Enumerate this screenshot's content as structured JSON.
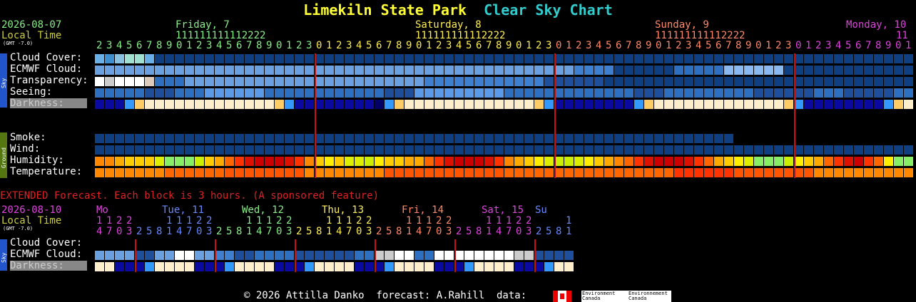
{
  "header": {
    "site": "Limekiln State Park",
    "chart": "Clear Sky Chart"
  },
  "top": {
    "date": "2026-08-07",
    "local_time": "Local Time",
    "gmt": "(GMT -7.0)",
    "days": [
      {
        "label": "Friday, 7",
        "color": "#88ee88"
      },
      {
        "label": "Saturday, 8",
        "color": "#ffee55"
      },
      {
        "label": "Sunday, 9",
        "color": "#ff8866"
      },
      {
        "label": "Monday, 10",
        "color": "#dd44dd"
      }
    ],
    "tens_rows": [
      "          1111111111112222",
      "                    1111111111112222",
      "                    1111111111112222",
      "                    11"
    ],
    "hours_digits": "234567890123456789012301234567890123456789012301234567890123456789012301234567890123456789012301234567890123456789012301"
  },
  "rows": {
    "sky": [
      "Cloud Cover:",
      "ECMWF Cloud:",
      "Transparency:",
      "Seeing:",
      "Darkness:"
    ],
    "ground": [
      "Smoke:",
      "Wind:",
      "Humidity:",
      "Temperature:"
    ]
  },
  "side_labels": {
    "sky": "Sky",
    "ground": "Ground"
  },
  "extended": {
    "notice": "EXTENDED Forecast. Each block is 3 hours. (A sponsored feature)",
    "date": "2026-08-10",
    "local_time": "Local Time",
    "gmt": "(GMT -7.0)",
    "days": [
      {
        "label": "Mo",
        "color": "#dd44dd"
      },
      {
        "label": "Tue, 11",
        "color": "#6688ff"
      },
      {
        "label": "Wed, 12",
        "color": "#88ee88"
      },
      {
        "label": "Thu, 13",
        "color": "#ffee55"
      },
      {
        "label": "Fri, 14",
        "color": "#ff8866"
      },
      {
        "label": "Sat, 15",
        "color": "#dd44dd"
      },
      {
        "label": "Su",
        "color": "#6688ff"
      }
    ],
    "tens": "1122   11122   11122   11122   11122   11122   1",
    "hours": "470325814703258147032581470325814703258147032581",
    "rows": [
      "Cloud Cover:",
      "ECMWF Cloud:",
      "Darkness:"
    ]
  },
  "footer": {
    "text": "© 2026 Attilla Danko  forecast: A.Rahill  data:",
    "agency1": "Environment Canada",
    "agency2": "Environnement Canada"
  },
  "colors": {
    "title": "#ffff33",
    "subtitle": "#33cccc",
    "label": "#ffffff",
    "darkness_label_bg": "#888888",
    "midnight_line": "#cc1111",
    "notice": "#dd2222",
    "local": "#cccc44"
  }
}
